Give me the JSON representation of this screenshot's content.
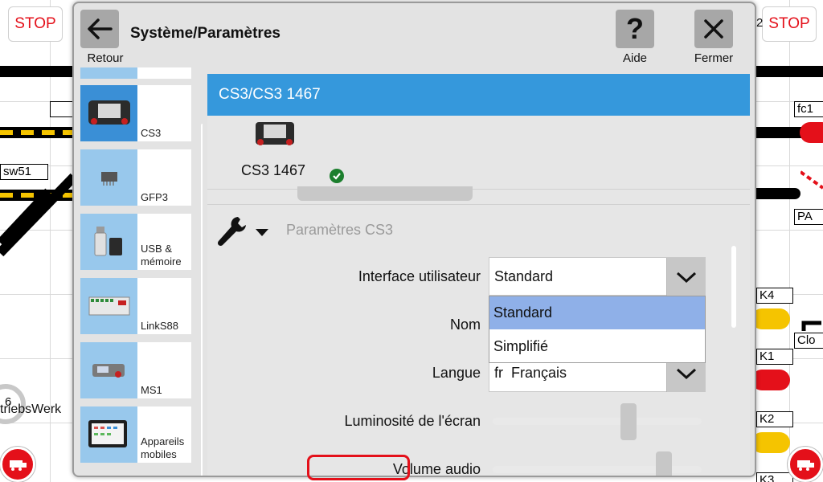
{
  "dialog": {
    "title": "Système/Paramètres",
    "back_label": "Retour",
    "help_label": "Aide",
    "close_label": "Fermer",
    "help_glyph": "?"
  },
  "sidebar": {
    "items": [
      {
        "label": "CS3",
        "icon": "cs3-device-icon"
      },
      {
        "label": "GFP3",
        "icon": "gfp3-chip-icon"
      },
      {
        "label": "USB & mémoire",
        "icon": "usb-storage-icon"
      },
      {
        "label": "LinkS88",
        "icon": "links88-module-icon"
      },
      {
        "label": "MS1",
        "icon": "ms1-controller-icon"
      },
      {
        "label": "Appareils mobiles",
        "icon": "mobile-device-icon"
      }
    ]
  },
  "device": {
    "header": "CS3/CS3 1467",
    "name": "CS3 1467",
    "status": "connected"
  },
  "settings": {
    "section_title": "Paramètres CS3",
    "ui_label": "Interface utilisateur",
    "ui_value": "Standard",
    "ui_options": [
      "Standard",
      "Simplifié"
    ],
    "ui_selected_option": "Standard",
    "name_label": "Nom",
    "language_label": "Langue",
    "language_value": "fr  Français",
    "brightness_label": "Luminosité de l'écran",
    "brightness_level": 0.65,
    "volume_label": "Volume audio",
    "volume_level": 0.82
  },
  "background": {
    "stop_label": "STOP",
    "track_labels": [
      "sw51",
      "fc1",
      "PA",
      "K4",
      "K1",
      "K2",
      "Clo",
      "K3"
    ],
    "depot_label": "triebsWerk",
    "depot_number": "6",
    "left_edge_label": "2"
  },
  "colors": {
    "accent": "#3598dc",
    "stop": "#e4101a",
    "selected_option": "#8fb0e8",
    "ok": "#1c7f2e"
  }
}
